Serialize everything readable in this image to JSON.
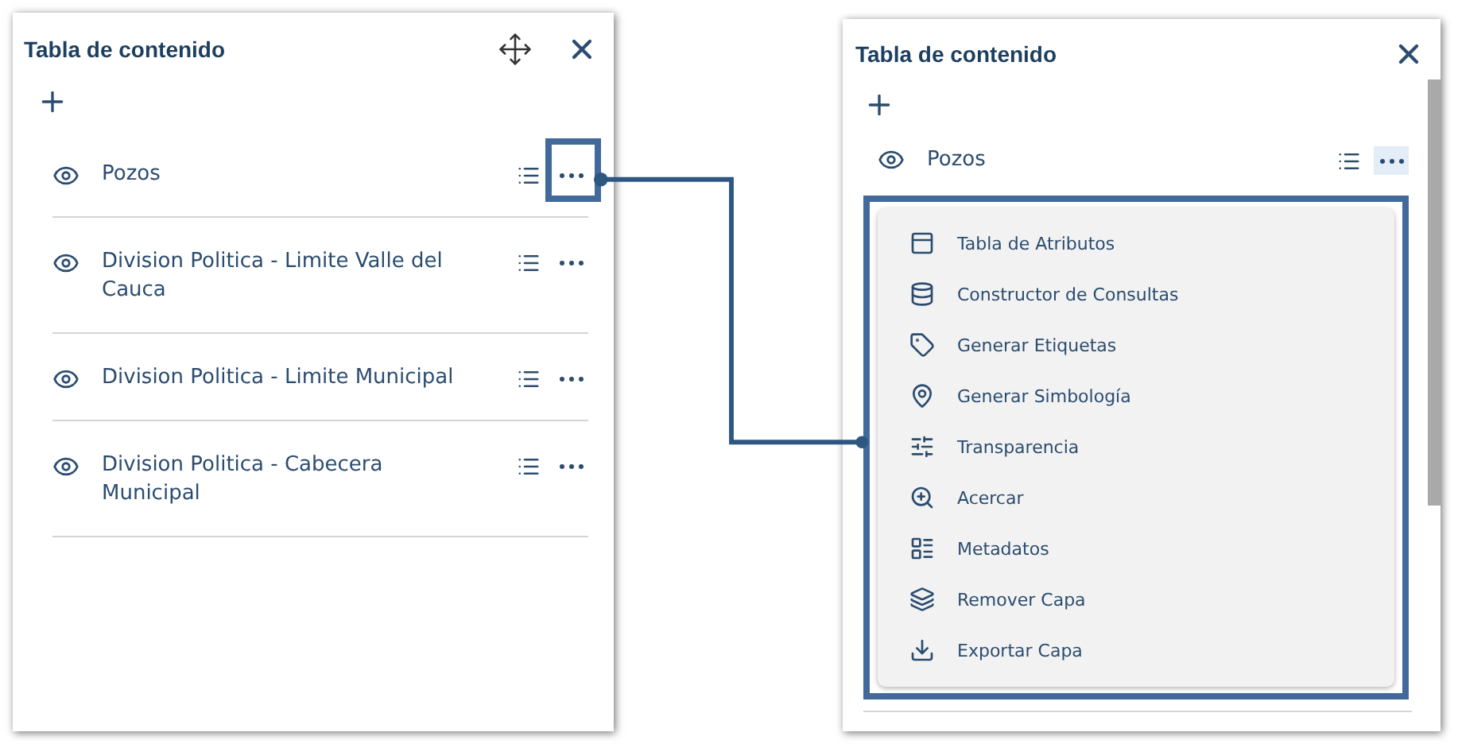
{
  "left_panel": {
    "title": "Tabla de contenido",
    "layers": [
      {
        "name": "Pozos",
        "highlighted": true
      },
      {
        "name": "Division Politica - Limite Valle del Cauca",
        "highlighted": false
      },
      {
        "name": "Division Politica - Limite Municipal",
        "highlighted": false
      },
      {
        "name": "Division Politica - Cabecera Municipal",
        "highlighted": false
      }
    ]
  },
  "right_panel": {
    "title": "Tabla de contenido",
    "layer": {
      "name": "Pozos",
      "actions_open": true
    },
    "menu": [
      {
        "label": "Tabla de Atributos"
      },
      {
        "label": "Constructor de Consultas"
      },
      {
        "label": "Generar Etiquetas"
      },
      {
        "label": "Generar Simbología"
      },
      {
        "label": "Transparencia"
      },
      {
        "label": "Acercar"
      },
      {
        "label": "Metadatos"
      },
      {
        "label": "Remover Capa"
      },
      {
        "label": "Exportar Capa"
      }
    ]
  }
}
